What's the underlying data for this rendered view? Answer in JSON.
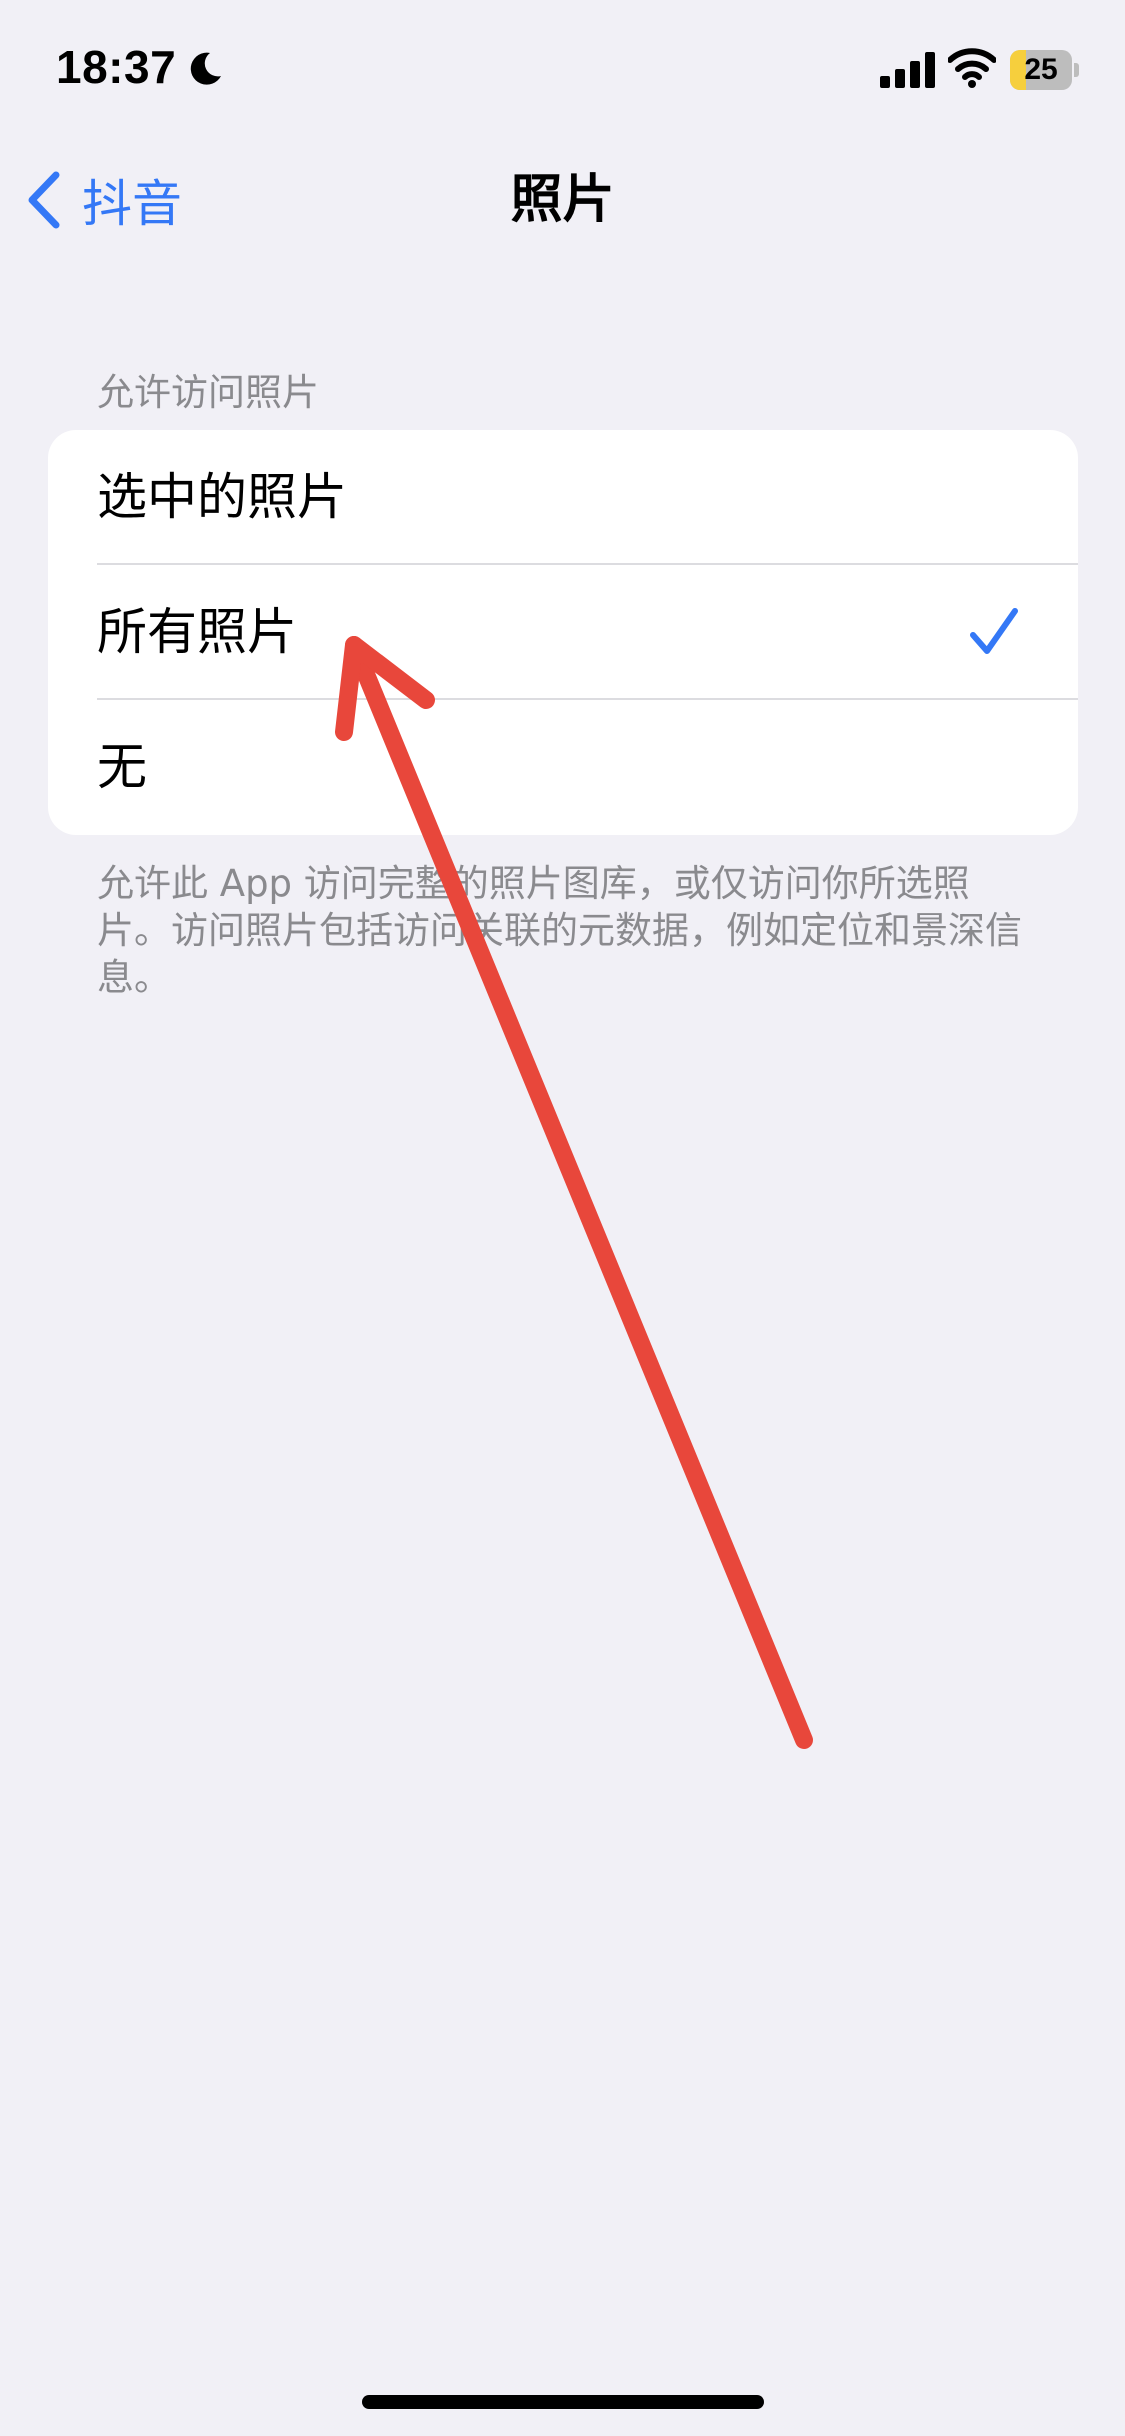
{
  "status_bar": {
    "time": "18:37",
    "battery_level": "25",
    "battery_fraction": 0.25,
    "icons": [
      "moon-icon",
      "signal-icon",
      "wifi-icon",
      "battery-icon"
    ]
  },
  "nav": {
    "back_label": "抖音",
    "title": "照片"
  },
  "section": {
    "header": "允许访问照片",
    "options": [
      {
        "label": "选中的照片",
        "selected": false
      },
      {
        "label": "所有照片",
        "selected": true
      },
      {
        "label": "无",
        "selected": false
      }
    ],
    "footer": "允许此 App 访问完整的照片图库，或仅访问你所选照片。访问照片包括访问关联的元数据，例如定位和景深信息。"
  },
  "colors": {
    "background": "#f1f0f6",
    "accent": "#3478f6",
    "annotation_arrow": "#e8473b",
    "battery_low": "#f6cf3d"
  }
}
